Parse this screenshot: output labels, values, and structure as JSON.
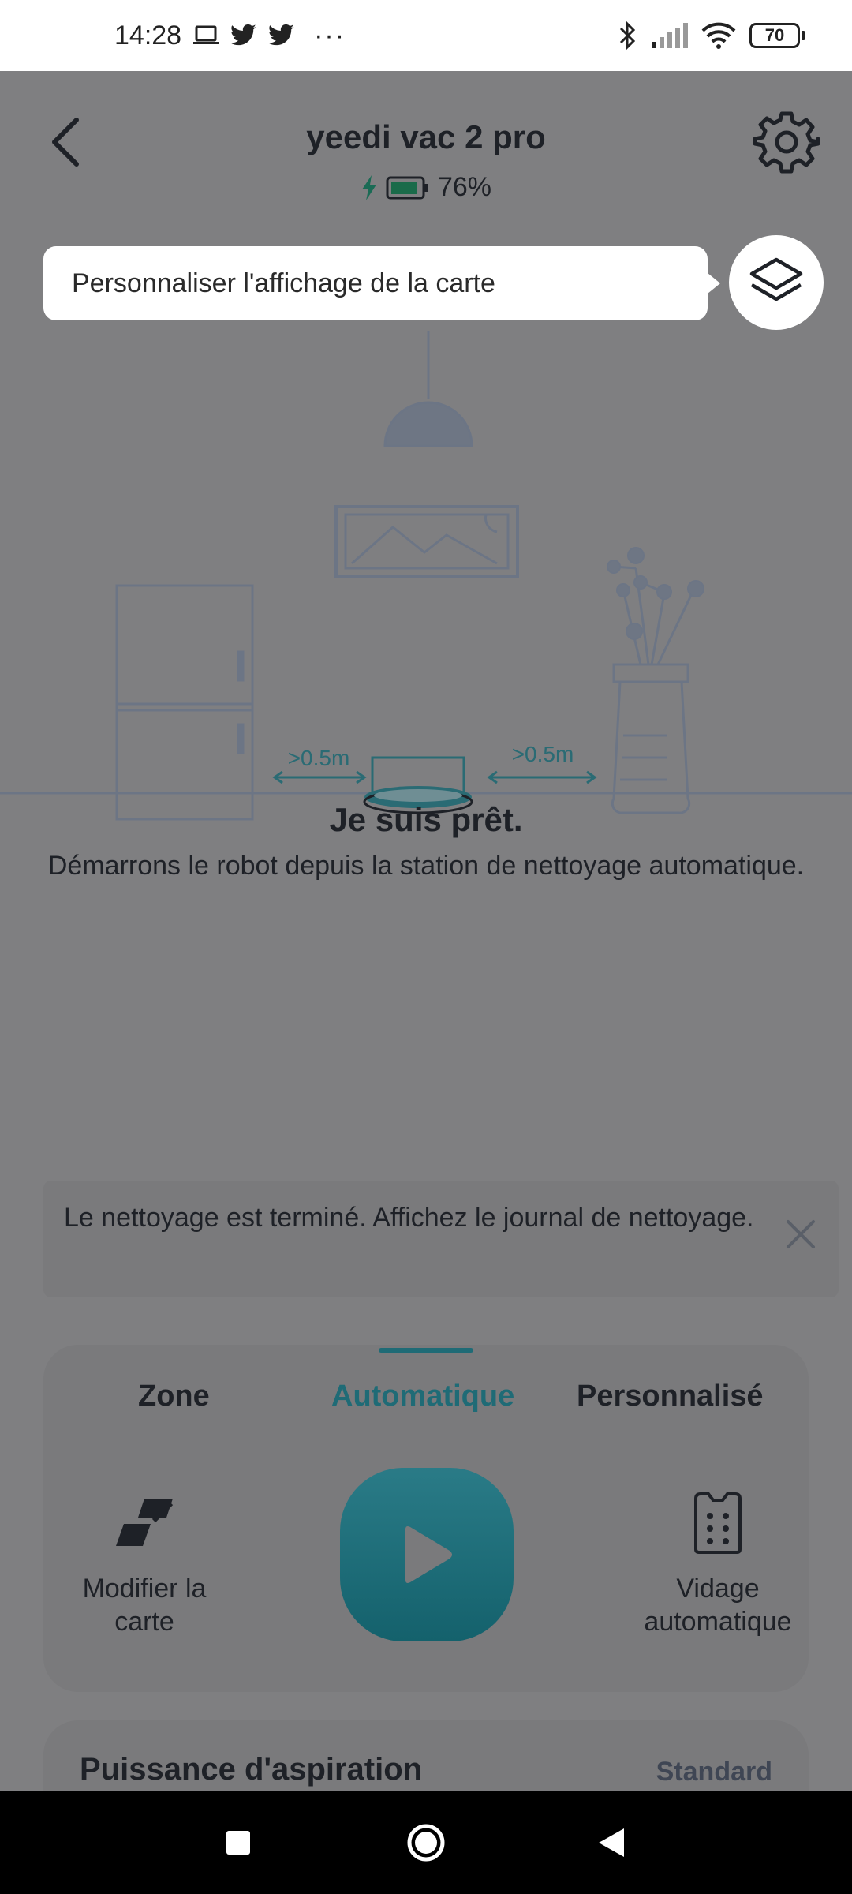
{
  "status_bar": {
    "time": "14:28",
    "battery_level": "70",
    "more": "···",
    "left_icons": [
      "laptop-icon",
      "twitter-icon",
      "twitter-icon"
    ],
    "right_icons": [
      "bluetooth-icon",
      "signal-icon",
      "wifi-icon",
      "battery-icon"
    ]
  },
  "header": {
    "title": "yeedi vac 2 pro",
    "battery_percent": "76%",
    "icons": [
      "back-arrow-icon",
      "gear-icon",
      "charging-bolt-icon",
      "battery-icon"
    ]
  },
  "tooltip": {
    "text": "Personnaliser l'affichage de la carte",
    "icon": "layers-icon"
  },
  "illustration": {
    "left_distance": ">0.5m",
    "right_distance": ">0.5m"
  },
  "status_message": {
    "title": "Je suis prêt.",
    "subtitle": "Démarrons le robot depuis la station de nettoyage automatique."
  },
  "notice": {
    "text": "Le nettoyage est terminé. Affichez le journal de nettoyage.",
    "close_icon": "close-icon"
  },
  "mode_card": {
    "tabs": [
      {
        "label": "Zone",
        "active": false
      },
      {
        "label": "Automatique",
        "active": true
      },
      {
        "label": "Personnalisé",
        "active": false
      }
    ],
    "edit_map_label": "Modifier la carte",
    "auto_empty_label": "Vidage automatique",
    "play_icon": "play-icon"
  },
  "suction": {
    "title": "Puissance d'aspiration",
    "value": "Standard"
  },
  "nav_bar": {
    "icons": [
      "recents-square-icon",
      "home-circle-icon",
      "back-triangle-icon"
    ]
  },
  "colors": {
    "overlay_background": "#7f7f81",
    "accent_teal": "#1f6b76",
    "text_dark": "#1e2127",
    "battery_green": "#1a8a5a"
  }
}
